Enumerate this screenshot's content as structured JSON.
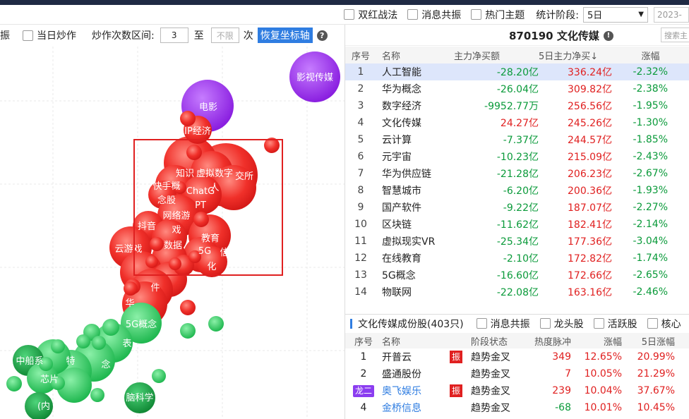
{
  "top_options": {
    "double_red": "双红战法",
    "news_resonance": "消息共振",
    "hot_theme": "热门主题",
    "stat_period_label": "统计阶段:",
    "stat_period_value": "5日",
    "date_value": "2023-"
  },
  "left_controls": {
    "prefix": "振",
    "same_day_label": "当日炒作",
    "range_label": "炒作次数区间:",
    "range_min": "3",
    "range_to": "至",
    "range_max_placeholder": "不限",
    "unit": "次",
    "reset_label": "恢复坐标轴",
    "help": "?"
  },
  "bubble_labels": [
    {
      "id": "b-film-media",
      "text": "影视传媒",
      "color": "#9b2ee0"
    },
    {
      "id": "b-movie",
      "text": "电影",
      "color": "#9b2ee0"
    },
    {
      "id": "b-ip",
      "text": "IP经济"
    },
    {
      "id": "b-knowledge",
      "text": "知识"
    },
    {
      "id": "b-vdigital",
      "text": "虚拟数字"
    },
    {
      "id": "b-vdigital2",
      "text": "人"
    },
    {
      "id": "b-exchange",
      "text": "交所"
    },
    {
      "id": "b-kuaishou",
      "text": "快手概"
    },
    {
      "id": "b-kuaishou2",
      "text": "念股"
    },
    {
      "id": "b-chatgpt",
      "text": "ChatG"
    },
    {
      "id": "b-chatgpt2",
      "text": "PT"
    },
    {
      "id": "b-netgame",
      "text": "网络游"
    },
    {
      "id": "b-netgame2",
      "text": "戏"
    },
    {
      "id": "b-douyin",
      "text": "抖音"
    },
    {
      "id": "b-edu",
      "text": "教育"
    },
    {
      "id": "b-cloudgame",
      "text": "云游戏"
    },
    {
      "id": "b-data",
      "text": "数据"
    },
    {
      "id": "b-5g",
      "text": "5G"
    },
    {
      "id": "b-xin",
      "text": "信"
    },
    {
      "id": "b-hua",
      "text": "化"
    },
    {
      "id": "b-jian",
      "text": "件"
    },
    {
      "id": "b-hua2",
      "text": "华"
    },
    {
      "id": "b-5gconcept",
      "text": "5G概念",
      "color": "#2bc45a"
    },
    {
      "id": "b-zhongchuan",
      "text": "中船系"
    },
    {
      "id": "b-special",
      "text": "特",
      "color": "#2bc45a"
    },
    {
      "id": "b-chip",
      "text": "芯片"
    },
    {
      "id": "b-braintech",
      "text": "脑科学",
      "color": "#2bc45a"
    },
    {
      "id": "b-inner",
      "text": "(内"
    },
    {
      "id": "b-nian",
      "text": "念"
    },
    {
      "id": "b-biao",
      "text": "表"
    }
  ],
  "stock": {
    "title": "870190 文化传媒",
    "search_placeholder": "搜索主"
  },
  "concept_table": {
    "headers": [
      "序号",
      "名称",
      "主力净买额",
      "5日主力净买↓",
      "涨幅"
    ],
    "rows": [
      {
        "idx": "1",
        "name": "人工智能",
        "net": "-28.20亿",
        "net5": "336.24亿",
        "chg": "-2.32%"
      },
      {
        "idx": "2",
        "name": "华为概念",
        "net": "-26.04亿",
        "net5": "309.82亿",
        "chg": "-2.38%"
      },
      {
        "idx": "3",
        "name": "数字经济",
        "net": "-9952.77万",
        "net5": "256.56亿",
        "chg": "-1.95%"
      },
      {
        "idx": "4",
        "name": "文化传媒",
        "net": "24.27亿",
        "net5": "245.26亿",
        "chg": "-1.30%"
      },
      {
        "idx": "5",
        "name": "云计算",
        "net": "-7.37亿",
        "net5": "244.57亿",
        "chg": "-1.85%"
      },
      {
        "idx": "6",
        "name": "元宇宙",
        "net": "-10.23亿",
        "net5": "215.09亿",
        "chg": "-2.43%"
      },
      {
        "idx": "7",
        "name": "华为供应链",
        "net": "-21.28亿",
        "net5": "206.23亿",
        "chg": "-2.67%"
      },
      {
        "idx": "8",
        "name": "智慧城市",
        "net": "-6.20亿",
        "net5": "200.36亿",
        "chg": "-1.93%"
      },
      {
        "idx": "9",
        "name": "国产软件",
        "net": "-9.22亿",
        "net5": "187.07亿",
        "chg": "-2.27%"
      },
      {
        "idx": "10",
        "name": "区块链",
        "net": "-11.62亿",
        "net5": "182.41亿",
        "chg": "-2.14%"
      },
      {
        "idx": "11",
        "name": "虚拟现实VR",
        "net": "-25.34亿",
        "net5": "177.36亿",
        "chg": "-3.04%"
      },
      {
        "idx": "12",
        "name": "在线教育",
        "net": "-2.10亿",
        "net5": "172.82亿",
        "chg": "-1.74%"
      },
      {
        "idx": "13",
        "name": "5G概念",
        "net": "-16.60亿",
        "net5": "172.66亿",
        "chg": "-2.65%"
      },
      {
        "idx": "14",
        "name": "物联网",
        "net": "-22.08亿",
        "net5": "163.16亿",
        "chg": "-2.46%"
      }
    ]
  },
  "constituents": {
    "title": "文化传媒成份股(403只)",
    "filters": [
      "消息共振",
      "龙头股",
      "活跃股",
      "核心"
    ],
    "headers": [
      "序号",
      "名称",
      "阶段状态",
      "热度脉冲",
      "涨幅",
      "5日涨幅"
    ],
    "rows": [
      {
        "idx": "1",
        "name": "开普云",
        "tag": "振",
        "state": "趋势金叉",
        "heat": "349",
        "chg": "12.65%",
        "chg5": "20.99%"
      },
      {
        "idx": "2",
        "name": "盛通股份",
        "tag": "",
        "state": "趋势金叉",
        "heat": "7",
        "chg": "10.05%",
        "chg5": "21.29%"
      },
      {
        "idx": "龙二",
        "name": "奥飞娱乐",
        "tag": "振",
        "state": "趋势金叉",
        "heat": "239",
        "chg": "10.04%",
        "chg5": "37.67%"
      },
      {
        "idx": "4",
        "name": "金桥信息",
        "tag": "",
        "state": "趋势金叉",
        "heat": "-68",
        "chg": "10.01%",
        "chg5": "10.45%"
      }
    ]
  }
}
